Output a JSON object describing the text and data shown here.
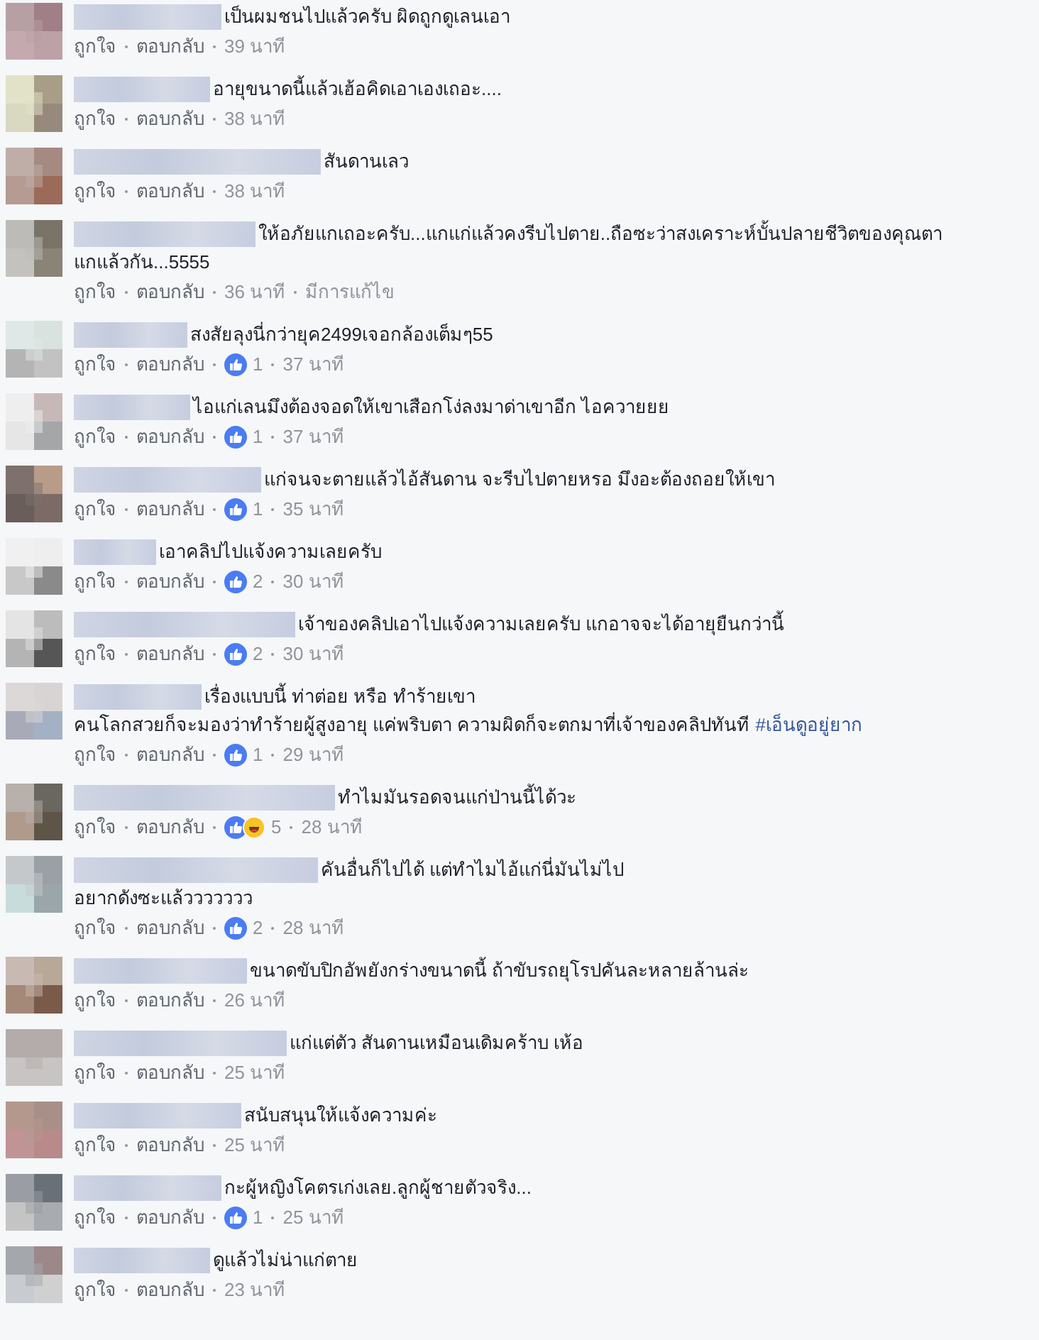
{
  "comments": [
    {
      "lines": [
        "เป็นผมชนไปแล้วครับ ผิดถูกดูเลนเอา"
      ],
      "like": "ถูกใจ",
      "reply": "ตอบกลับ",
      "time": "39 นาที"
    },
    {
      "lines": [
        "อายุขนาดนี้แล้วเฮ้อคิดเอาเองเถอะ...."
      ],
      "like": "ถูกใจ",
      "reply": "ตอบกลับ",
      "time": "38 นาที"
    },
    {
      "lines": [
        "สันดานเลว"
      ],
      "like": "ถูกใจ",
      "reply": "ตอบกลับ",
      "time": "38 นาที"
    },
    {
      "lines": [
        "ให้อภัยแกเถอะครับ...แกแก่แล้วคงรีบไปตาย..ถือซะว่าสงเคราะห์บั้นปลายชีวิตของคุณตา",
        "แกแล้วกัน...5555"
      ],
      "like": "ถูกใจ",
      "reply": "ตอบกลับ",
      "time": "36 นาที",
      "edited": "มีการแก้ไข"
    },
    {
      "lines": [
        "สงสัยลุงนี่กว่ายุค2499เจอกล้องเต็มๆ55"
      ],
      "like": "ถูกใจ",
      "reply": "ตอบกลับ",
      "reactions": [
        {
          "kind": "like"
        }
      ],
      "reaction_count": "1",
      "time": "37 นาที"
    },
    {
      "lines": [
        "ไอแก่เลนมึงต้องจอดให้เขาเสือกโง่ลงมาด่าเขาอีก ไอควายยย"
      ],
      "like": "ถูกใจ",
      "reply": "ตอบกลับ",
      "reactions": [
        {
          "kind": "like"
        }
      ],
      "reaction_count": "1",
      "time": "37 นาที"
    },
    {
      "lines": [
        "แก่จนจะตายแล้วไอ้สันดาน จะรีบไปตายหรอ มึงอะต้องถอยให้เขา"
      ],
      "like": "ถูกใจ",
      "reply": "ตอบกลับ",
      "reactions": [
        {
          "kind": "like"
        }
      ],
      "reaction_count": "1",
      "time": "35 นาที"
    },
    {
      "lines": [
        "เอาคลิปไปแจ้งความเลยครับ"
      ],
      "like": "ถูกใจ",
      "reply": "ตอบกลับ",
      "reactions": [
        {
          "kind": "like"
        }
      ],
      "reaction_count": "2",
      "time": "30 นาที"
    },
    {
      "lines": [
        "เจ้าของคลิปเอาไปแจ้งความเลยครับ แกอาจจะได้อายุยืนกว่านี้"
      ],
      "like": "ถูกใจ",
      "reply": "ตอบกลับ",
      "reactions": [
        {
          "kind": "like"
        }
      ],
      "reaction_count": "2",
      "time": "30 นาที"
    },
    {
      "lines": [
        "เรื่องแบบนี้ ท่าต่อย หรือ ทำร้ายเขา",
        "คนโลกสวยก็จะมองว่าทำร้ายผู้สูงอายุ แค่พริบตา ความผิดก็จะตกมาที่เจ้าของคลิปทันที"
      ],
      "hashtag": "#เอ็นดูอยู่ยาก",
      "like": "ถูกใจ",
      "reply": "ตอบกลับ",
      "reactions": [
        {
          "kind": "like"
        }
      ],
      "reaction_count": "1",
      "time": "29 นาที"
    },
    {
      "lines": [
        "ทำไมมันรอดจนแก่ป่านนี้ได้วะ"
      ],
      "like": "ถูกใจ",
      "reply": "ตอบกลับ",
      "reactions": [
        {
          "kind": "like"
        },
        {
          "kind": "haha"
        }
      ],
      "reaction_count": "5",
      "time": "28 นาที"
    },
    {
      "lines": [
        "คันอื่นก็ไปได้ แต่ทำไมไอ้แก่นี่มันไม่ไป",
        "อยากดังซะแล้ววววววว"
      ],
      "like": "ถูกใจ",
      "reply": "ตอบกลับ",
      "reactions": [
        {
          "kind": "like"
        }
      ],
      "reaction_count": "2",
      "time": "28 นาที"
    },
    {
      "lines": [
        "ขนาดขับปิกอัพยังกร่างขนาดนี้ ถ้าขับรถยุโรปคันละหลายล้านล่ะ"
      ],
      "like": "ถูกใจ",
      "reply": "ตอบกลับ",
      "time": "26 นาที"
    },
    {
      "lines": [
        "แก่แต่ตัว สันดานเหมือนเดิมคร้าบ เห้อ"
      ],
      "like": "ถูกใจ",
      "reply": "ตอบกลับ",
      "time": "25 นาที"
    },
    {
      "lines": [
        "สนับสนุนให้แจ้งความค่ะ"
      ],
      "like": "ถูกใจ",
      "reply": "ตอบกลับ",
      "time": "25 นาที"
    },
    {
      "lines": [
        "กะผู้หญิงโคตรเก่งเลย.ลูกผู้ชายตัวจริง..."
      ],
      "like": "ถูกใจ",
      "reply": "ตอบกลับ",
      "reactions": [
        {
          "kind": "like"
        }
      ],
      "reaction_count": "1",
      "time": "25 นาที"
    },
    {
      "lines": [
        "ดูแล้วไม่น่าแก่ตาย"
      ],
      "like": "ถูกใจ",
      "reply": "ตอบกลับ",
      "time": "23 นาที"
    }
  ]
}
